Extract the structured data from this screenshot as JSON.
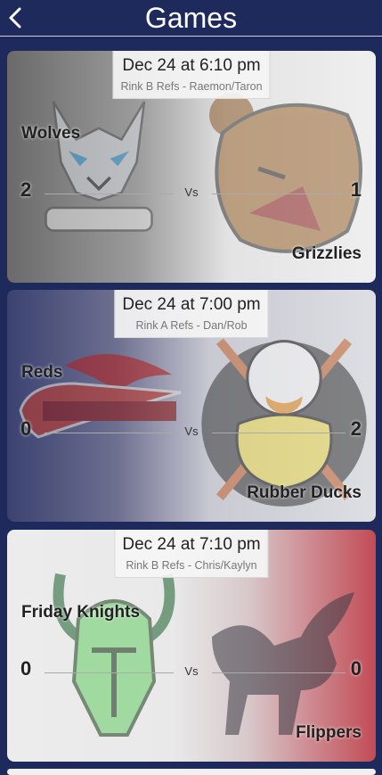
{
  "header": {
    "title": "Games",
    "back_icon": "chevron-left-icon"
  },
  "games": [
    {
      "date": "Dec 24 at 6:10 pm",
      "refs": "Rink B Refs - Raemon/Taron",
      "home": {
        "name": "Wolves",
        "score": "2",
        "logo_icon": "wolf-logo-icon"
      },
      "away": {
        "name": "Grizzlies",
        "score": "1",
        "logo_icon": "bear-logo-icon"
      },
      "vs": "Vs",
      "home_color": "#6d6d6d",
      "away_color": "#e4e4e4"
    },
    {
      "date": "Dec 24 at 7:00 pm",
      "refs": "Rink A Refs - Dan/Rob",
      "home": {
        "name": "Reds",
        "score": "0",
        "logo_icon": "redhawks-logo-icon"
      },
      "away": {
        "name": "Rubber Ducks",
        "score": "2",
        "logo_icon": "duck-logo-icon"
      },
      "vs": "Vs",
      "home_color": "#3c4470",
      "away_color": "#d8d8dc"
    },
    {
      "date": "Dec 24 at 7:10 pm",
      "refs": "Rink B Refs - Chris/Kaylyn",
      "home": {
        "name": "Friday Knights",
        "score": "0",
        "logo_icon": "knight-logo-icon"
      },
      "away": {
        "name": "Flippers",
        "score": "0",
        "logo_icon": "pegasus-logo-icon"
      },
      "vs": "Vs",
      "home_color": "#ececec",
      "away_color": "#c24b55"
    }
  ]
}
